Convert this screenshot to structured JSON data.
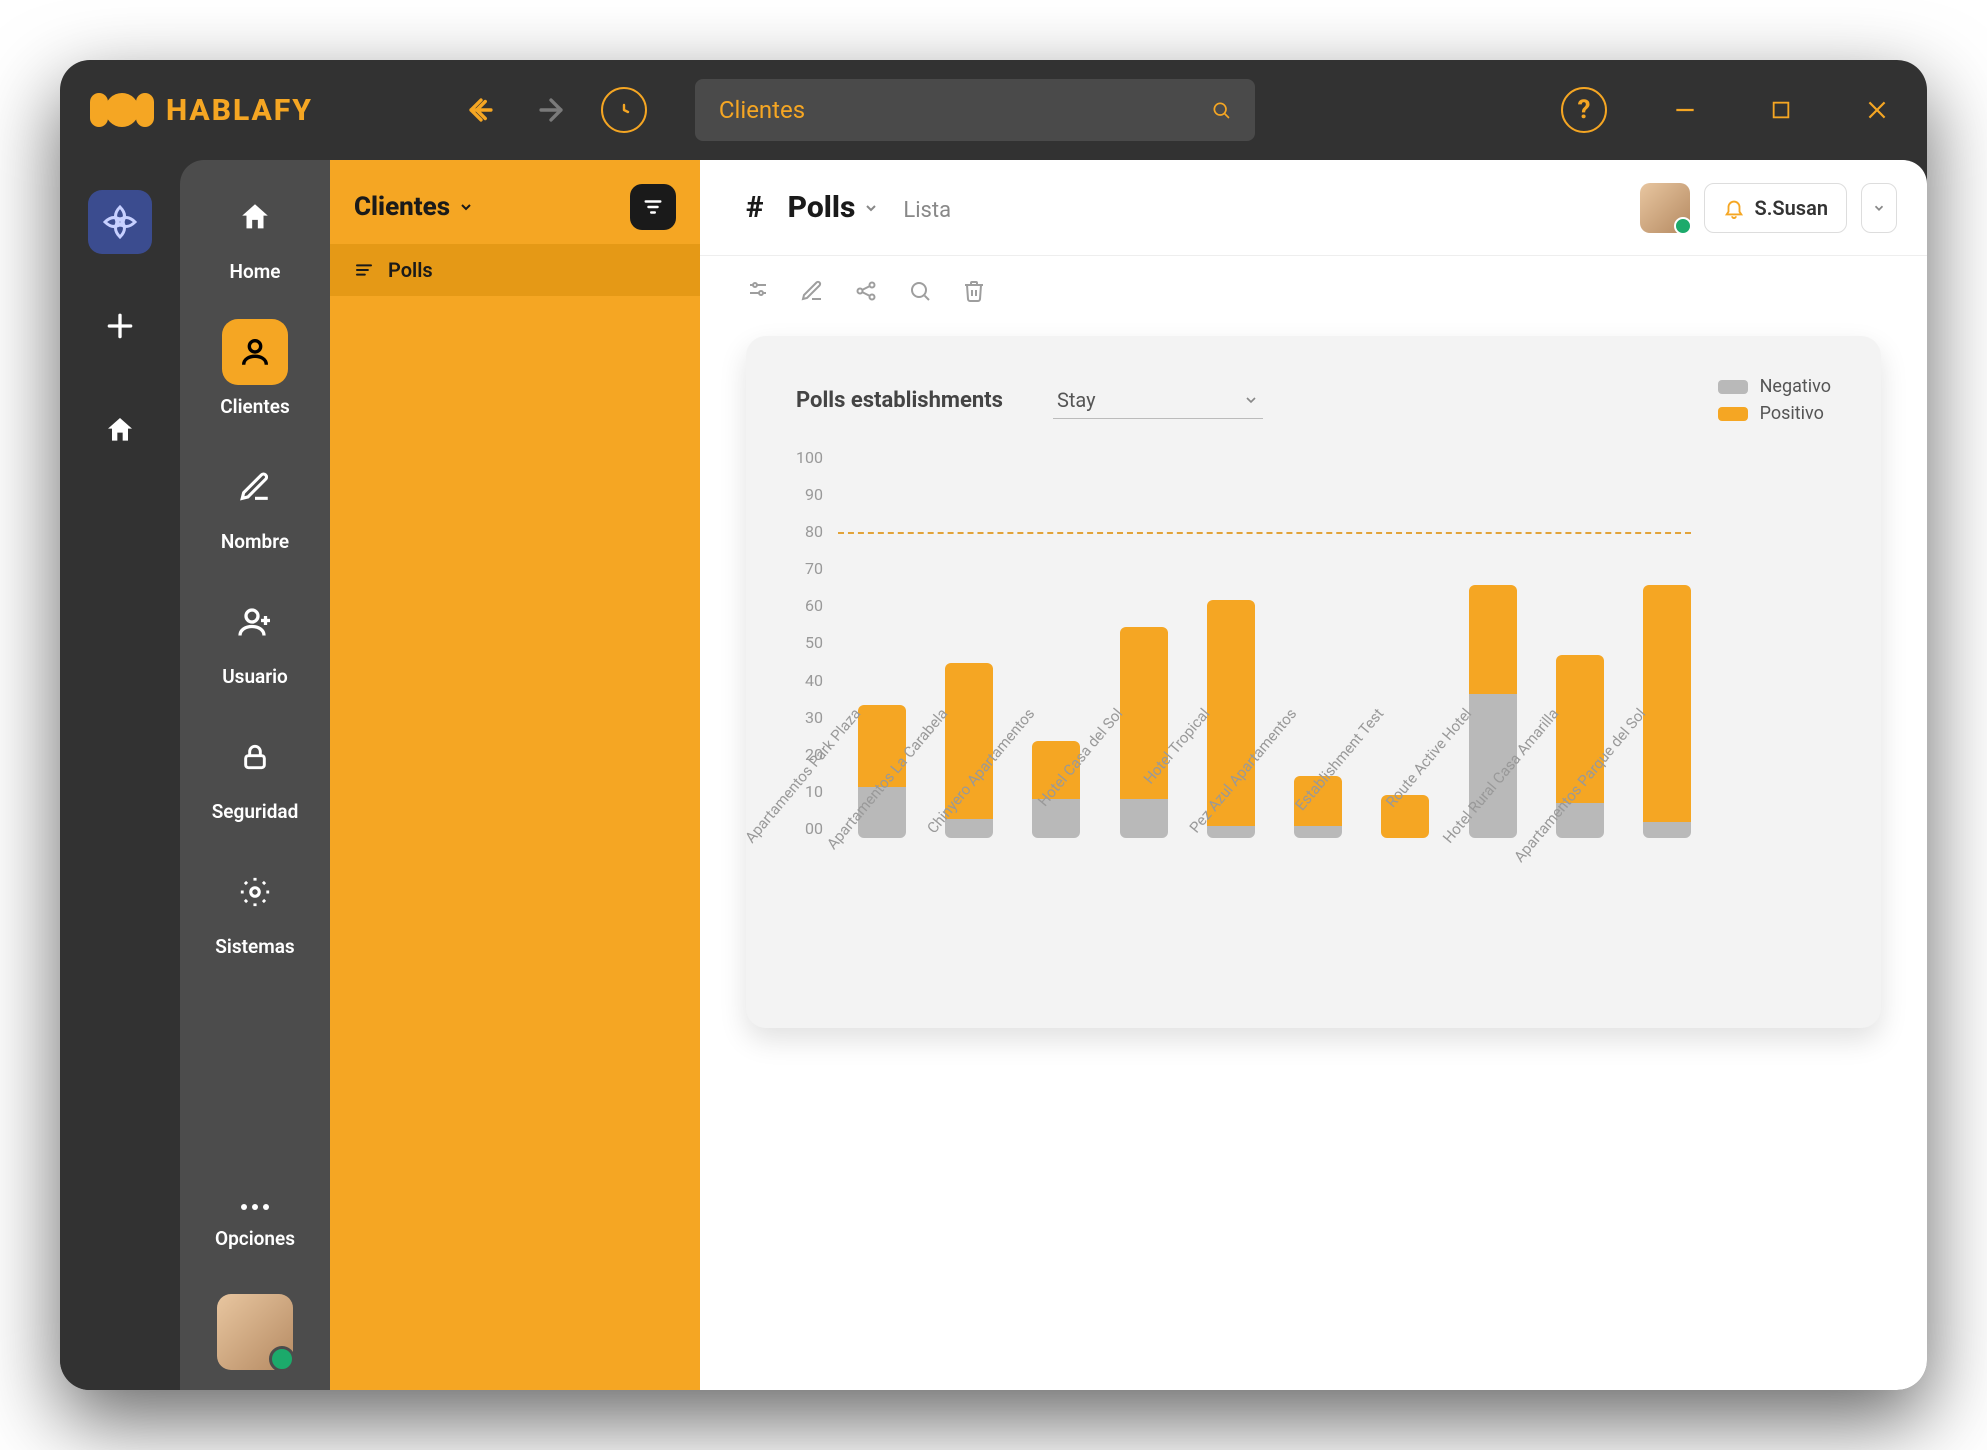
{
  "brand": {
    "name": "HABLAFY"
  },
  "searchbar": {
    "text": "Clientes"
  },
  "rail2": {
    "items": [
      {
        "label": "Home"
      },
      {
        "label": "Clientes"
      },
      {
        "label": "Nombre"
      },
      {
        "label": "Usuario"
      },
      {
        "label": "Seguridad"
      },
      {
        "label": "Sistemas"
      },
      {
        "label": "Opciones"
      }
    ]
  },
  "listpanel": {
    "title": "Clientes",
    "rows": [
      {
        "label": "Polls"
      }
    ]
  },
  "main": {
    "title": "Polls",
    "crumb": "Lista",
    "user": "S.Susan"
  },
  "chart": {
    "card_title": "Polls establishments",
    "select_value": "Stay",
    "legend": {
      "neg": "Negativo",
      "pos": "Positivo"
    },
    "colors": {
      "neg": "#b9b9b9",
      "pos": "#f5a623"
    },
    "target": 78
  },
  "chart_data": {
    "type": "bar",
    "ylim": [
      0,
      100
    ],
    "yticks": [
      "100",
      "90",
      "80",
      "70",
      "60",
      "50",
      "40",
      "30",
      "20",
      "10",
      "00"
    ],
    "categories": [
      "Apartamentos Park Plaza",
      "Apartamentos La Carabela",
      "Chinyero Apartamentos",
      "Hotel Casa del Sol",
      "Hotel Tropical",
      "Pez Azul Apartamentos",
      "Establishment Test",
      "Route Active Hotel",
      "Hotel Rural Casa Amarilla",
      "Apartamentos Parque del Sol"
    ],
    "series": [
      {
        "name": "Negativo",
        "values": [
          13,
          5,
          10,
          10,
          3,
          3,
          0,
          37,
          9,
          4
        ]
      },
      {
        "name": "Positivo",
        "values": [
          21,
          40,
          15,
          44,
          58,
          13,
          11,
          28,
          38,
          61
        ]
      }
    ]
  }
}
